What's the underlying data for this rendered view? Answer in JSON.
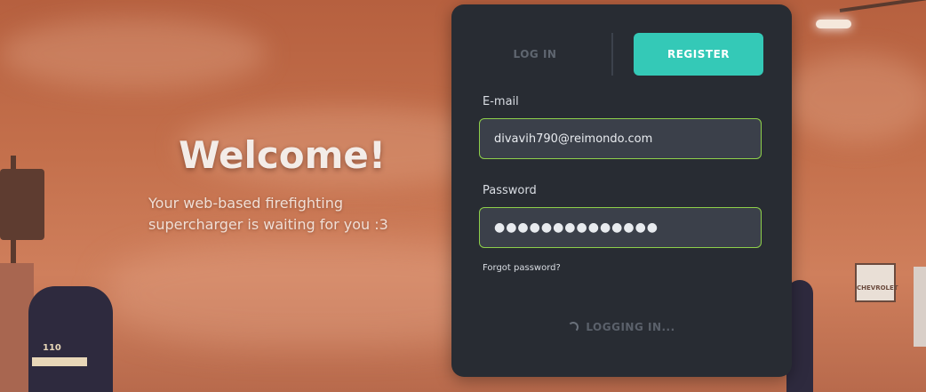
{
  "hero": {
    "title": "Welcome!",
    "subtitle": "Your web-based firefighting supercharger is waiting for you :3"
  },
  "background": {
    "billboard_text": "CHEVROLET",
    "helmet_number": "110"
  },
  "auth": {
    "tabs": {
      "login": "LOG IN",
      "register": "REGISTER",
      "active": "register"
    },
    "email": {
      "label": "E-mail",
      "value": "divavih790@reimondo.com"
    },
    "password": {
      "label": "Password",
      "value": "●●●●●●●●●●●●●●"
    },
    "forgot_label": "Forgot password?",
    "submit_status": "LOGGING IN..."
  },
  "colors": {
    "accent": "#34c9b7",
    "valid_border": "#8ed04a",
    "panel": "#282c33",
    "field": "#3b404a"
  }
}
